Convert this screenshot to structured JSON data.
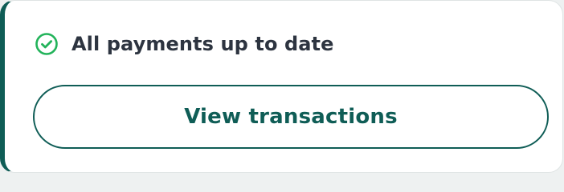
{
  "status": {
    "icon": "check-circle-icon",
    "text": "All payments up to date",
    "icon_color": "#22b35a"
  },
  "actions": {
    "view_transactions_label": "View transactions"
  },
  "colors": {
    "accent": "#0f5d56",
    "text": "#2d3440",
    "background": "#ffffff"
  }
}
